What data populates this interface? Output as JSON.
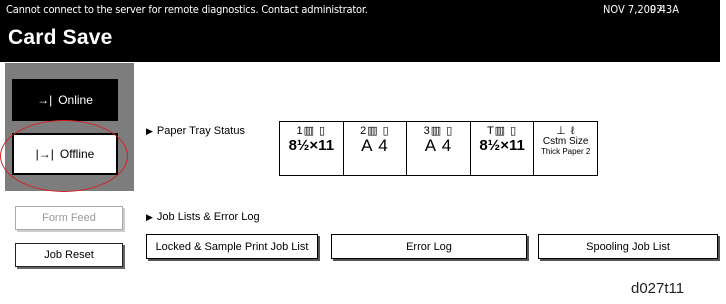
{
  "status_bar": {
    "message": "Cannot connect to the server for remote diagnostics. Contact administrator.",
    "date": "NOV   7,2007",
    "time": "9:43A"
  },
  "screen": {
    "title": "Card Save"
  },
  "mode": {
    "online_label": "Online",
    "offline_label": "Offline",
    "online_icon": "→|",
    "offline_icon": "|→|"
  },
  "side_buttons": {
    "form_feed": "Form Feed",
    "job_reset": "Job Reset"
  },
  "paper_tray": {
    "label": "Paper Tray Status",
    "trays": [
      {
        "header": "1▥ ▯",
        "size": "8½×11"
      },
      {
        "header": "2▥ ▯",
        "size": "A 4"
      },
      {
        "header": "3▥ ▯",
        "size": "A 4"
      },
      {
        "header": "T▥ ▯",
        "size": "8½×11"
      },
      {
        "header": "⊥ ℓ",
        "size": "Cstm Size",
        "note": "Thick Paper 2"
      }
    ]
  },
  "job_lists": {
    "label": "Job Lists & Error Log",
    "buttons": {
      "locked": "Locked & Sample Print Job List",
      "error_log": "Error Log",
      "spooling": "Spooling Job List"
    }
  },
  "figure_label": "d027t11"
}
